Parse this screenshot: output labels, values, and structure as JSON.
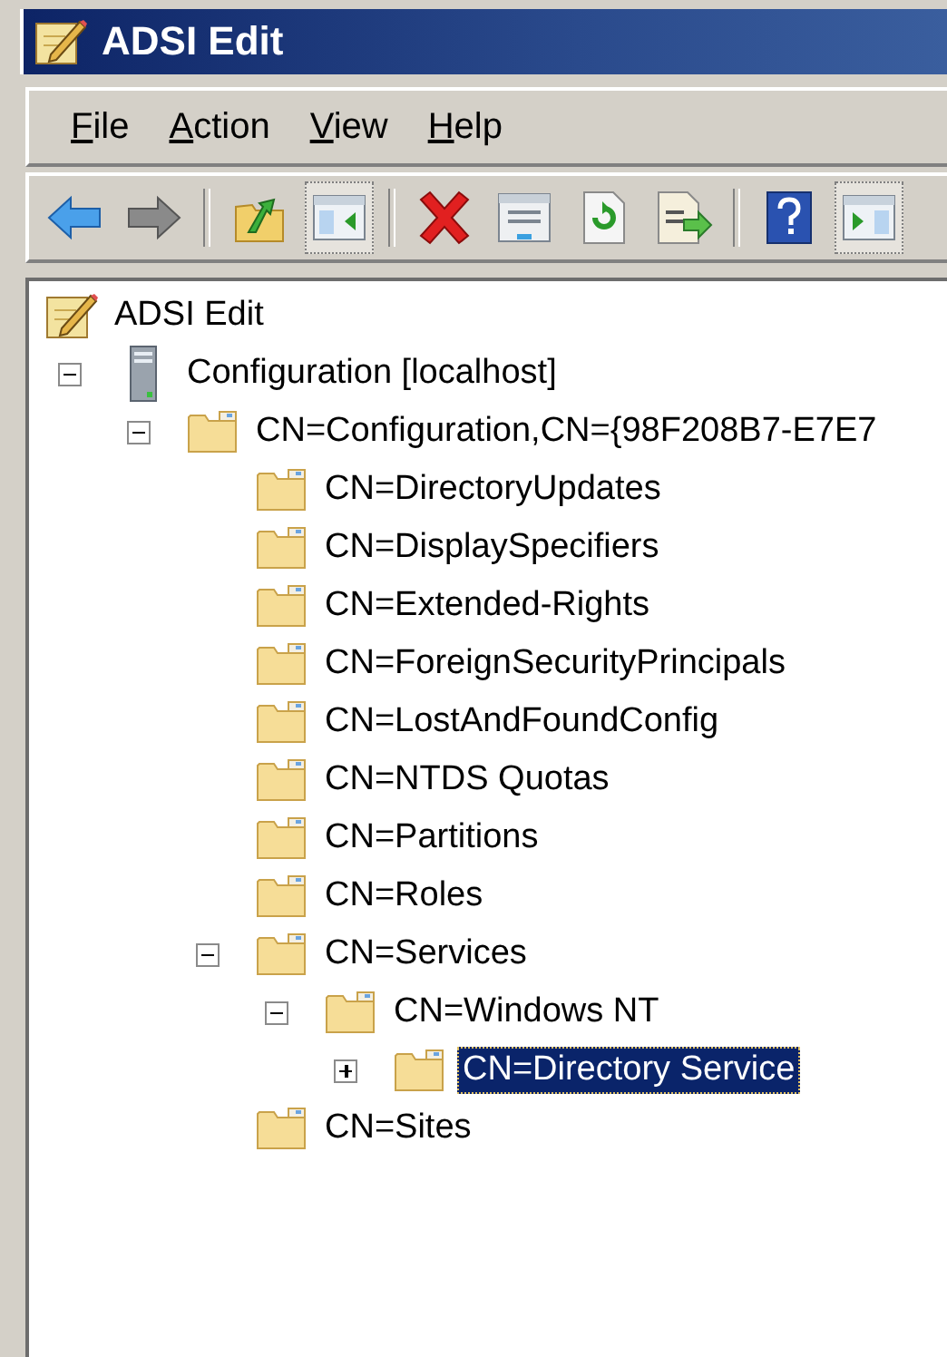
{
  "window": {
    "title": "ADSI Edit"
  },
  "menu": [
    {
      "label": "File"
    },
    {
      "label": "Action"
    },
    {
      "label": "View"
    },
    {
      "label": "Help"
    }
  ],
  "toolbar": [
    [
      {
        "pressed": false
      },
      {
        "pressed": false
      }
    ],
    [
      {
        "pressed": false
      },
      {
        "pressed": true
      }
    ],
    [
      {
        "pressed": false
      },
      {
        "pressed": false
      },
      {
        "pressed": false
      },
      {
        "pressed": false
      }
    ],
    [
      {
        "pressed": false
      },
      {
        "pressed": true
      }
    ]
  ],
  "tree": {
    "label": "ADSI Edit",
    "kind": "snapin",
    "selected": false,
    "children": [
      {
        "label": "Configuration [localhost]",
        "kind": "server",
        "expanded": true,
        "selected": false,
        "children": [
          {
            "label": "CN=Configuration,CN={98F208B7-E7E7",
            "kind": "folder",
            "expanded": true,
            "selected": false,
            "children": [
              {
                "label": "CN=DirectoryUpdates",
                "kind": "folder",
                "selected": false
              },
              {
                "label": "CN=DisplaySpecifiers",
                "kind": "folder",
                "selected": false
              },
              {
                "label": "CN=Extended-Rights",
                "kind": "folder",
                "selected": false
              },
              {
                "label": "CN=ForeignSecurityPrincipals",
                "kind": "folder",
                "selected": false
              },
              {
                "label": "CN=LostAndFoundConfig",
                "kind": "folder",
                "selected": false
              },
              {
                "label": "CN=NTDS Quotas",
                "kind": "folder",
                "selected": false
              },
              {
                "label": "CN=Partitions",
                "kind": "folder",
                "selected": false
              },
              {
                "label": "CN=Roles",
                "kind": "folder",
                "selected": false
              },
              {
                "label": "CN=Services",
                "kind": "folder",
                "expanded": true,
                "selected": false,
                "children": [
                  {
                    "label": "CN=Windows NT",
                    "kind": "folder",
                    "expanded": true,
                    "selected": false,
                    "children": [
                      {
                        "label": "CN=Directory Service",
                        "kind": "folder",
                        "expanded": false,
                        "selected": true
                      }
                    ]
                  }
                ]
              },
              {
                "label": "CN=Sites",
                "kind": "folder",
                "selected": false
              }
            ]
          }
        ]
      }
    ]
  }
}
